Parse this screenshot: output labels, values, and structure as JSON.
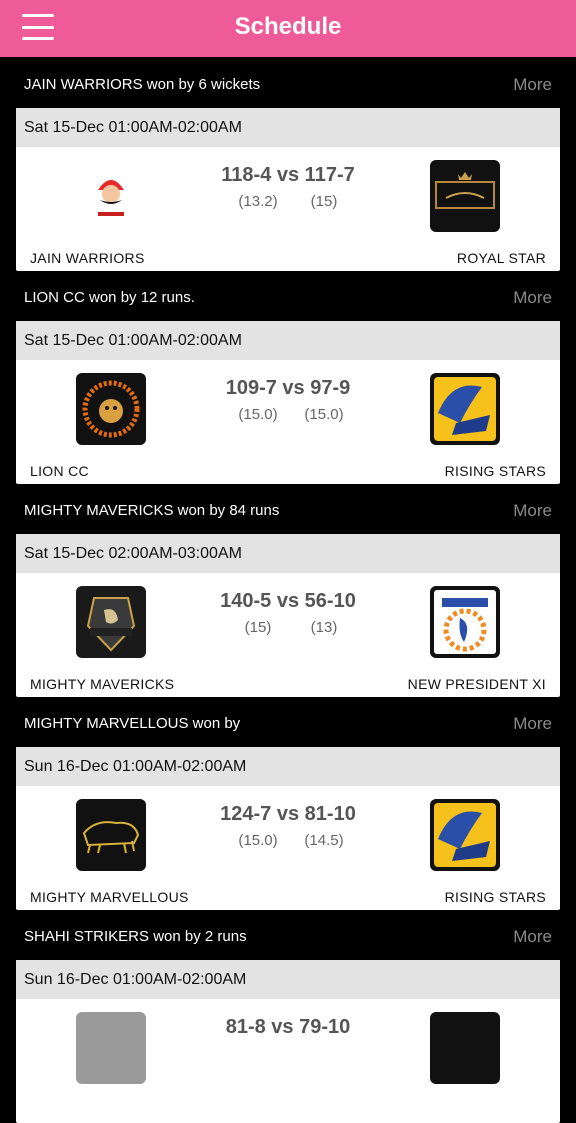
{
  "header": {
    "title": "Schedule",
    "menu_icon": "hamburger-menu-icon"
  },
  "more_label": "More",
  "matches": [
    {
      "result": "JAIN WARRIORS won by 6 wickets",
      "datetime": "Sat 15-Dec 01:00AM-02:00AM",
      "score": "118-4 vs 117-7",
      "team1": {
        "name": "JAIN WARRIORS",
        "overs": "(13.2)",
        "logo": "jain-warriors-logo"
      },
      "team2": {
        "name": "ROYAL STAR",
        "overs": "(15)",
        "logo": "royal-star-logo"
      }
    },
    {
      "result": "LION CC won by 12 runs.",
      "datetime": "Sat 15-Dec 01:00AM-02:00AM",
      "score": "109-7 vs 97-9",
      "team1": {
        "name": "LION CC",
        "overs": "(15.0)",
        "logo": "lion-cc-logo"
      },
      "team2": {
        "name": "RISING STARS",
        "overs": "(15.0)",
        "logo": "rising-stars-logo"
      }
    },
    {
      "result": "MIGHTY MAVERICKS won by 84 runs",
      "datetime": "Sat 15-Dec 02:00AM-03:00AM",
      "score": "140-5 vs 56-10",
      "team1": {
        "name": "MIGHTY MAVERICKS",
        "overs": "(15)",
        "logo": "mighty-mavericks-logo"
      },
      "team2": {
        "name": "NEW PRESIDENT XI",
        "overs": "(13)",
        "logo": "new-president-xi-logo"
      }
    },
    {
      "result": "MIGHTY MARVELLOUS won by",
      "datetime": "Sun 16-Dec 01:00AM-02:00AM",
      "score": "124-7 vs 81-10",
      "team1": {
        "name": "MIGHTY MARVELLOUS",
        "overs": "(15.0)",
        "logo": "mighty-marvellous-logo"
      },
      "team2": {
        "name": "RISING STARS",
        "overs": "(14.5)",
        "logo": "rising-stars-logo"
      }
    },
    {
      "result": "SHAHI STRIKERS won by 2 runs",
      "datetime": "Sun 16-Dec 01:00AM-02:00AM",
      "score": "81-8 vs 79-10",
      "team1": {
        "name": "",
        "overs": "",
        "logo": "shahi-strikers-logo"
      },
      "team2": {
        "name": "",
        "overs": "",
        "logo": "opponent-logo"
      }
    }
  ]
}
